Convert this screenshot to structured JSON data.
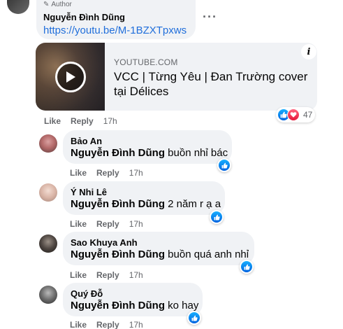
{
  "main_comment": {
    "author_badge": "Author",
    "author_name": "Nguyễn Đình Dũng",
    "link": "https://youtu.be/M-1BZXTpxws",
    "more_icon": "more-dots-icon",
    "preview": {
      "source": "YOUTUBE.COM",
      "title_line1": "VCC | Từng Yêu | Đan Trường cover",
      "title_line2": "tại Délices",
      "info_icon": "info-icon"
    },
    "reactions_count": "47",
    "actions": {
      "like": "Like",
      "reply": "Reply",
      "time": "17h"
    }
  },
  "replies": [
    {
      "author": "Bảo An",
      "mention": "Nguyễn Đình Dũng",
      "text": " buồn nhỉ bác",
      "like": "Like",
      "reply": "Reply",
      "time": "17h"
    },
    {
      "author": "Ý Nhi Lê",
      "mention": "Nguyễn Đình Dũng",
      "text": " 2 năm r ạ a",
      "like": "Like",
      "reply": "Reply",
      "time": "17h"
    },
    {
      "author": "Sao Khuya Anh",
      "mention": "Nguyễn Đình Dũng",
      "text": " buồn quá anh nhỉ",
      "like": "Like",
      "reply": "Reply",
      "time": "17h"
    },
    {
      "author": "Quý Đỗ",
      "mention": "Nguyễn Đình Dũng",
      "text": " ko hay",
      "like": "Like",
      "reply": "Reply",
      "time": "17h"
    }
  ],
  "colors": {
    "bubble": "#f0f2f5",
    "link": "#216fdb",
    "meta": "#65676b",
    "like_blue": "#1877f2",
    "love_red": "#f33e58"
  }
}
